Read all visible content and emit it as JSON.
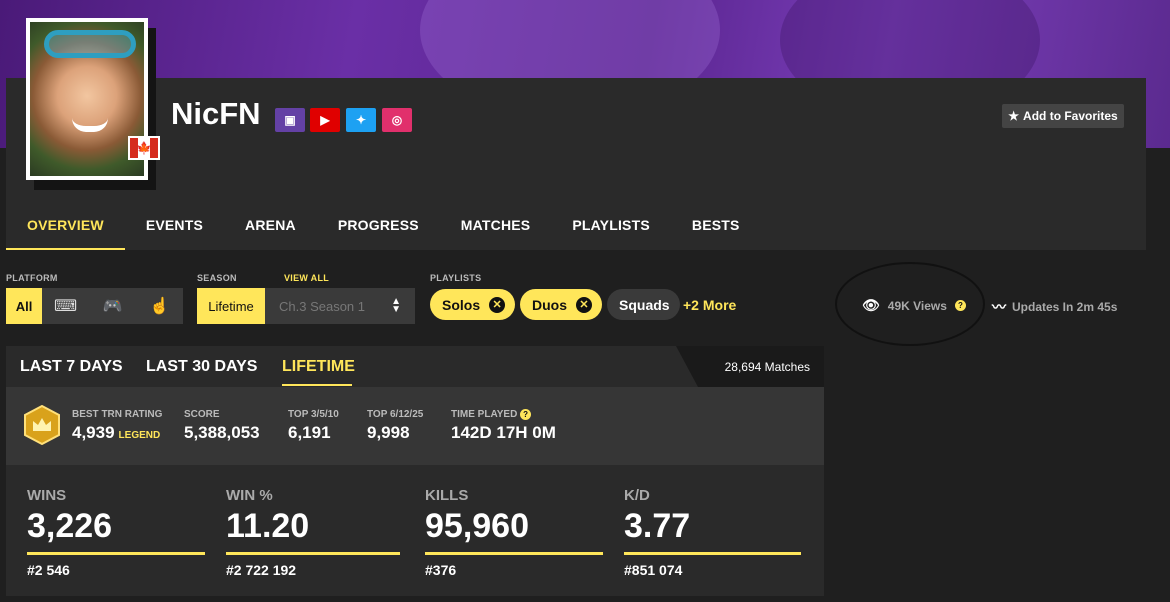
{
  "profile": {
    "name": "NicFN",
    "flag": "🍁",
    "favorite_label": "Add to Favorites",
    "social": [
      {
        "icon": "twitch-icon",
        "color": "#6441a5",
        "glyph": "▣"
      },
      {
        "icon": "youtube-icon",
        "color": "#e00000",
        "glyph": "▶"
      },
      {
        "icon": "twitter-icon",
        "color": "#1da1f2",
        "glyph": "✦"
      },
      {
        "icon": "instagram-icon",
        "color": "#e1306c",
        "glyph": "◎"
      }
    ]
  },
  "nav": {
    "tabs": [
      "OVERVIEW",
      "EVENTS",
      "ARENA",
      "PROGRESS",
      "MATCHES",
      "PLAYLISTS",
      "BESTS"
    ]
  },
  "filters": {
    "platform_label": "PLATFORM",
    "platform_all": "All",
    "season_label": "SEASON",
    "season_view_all": "VIEW ALL",
    "season_lifetime": "Lifetime",
    "season_select": "Ch.3 Season 1",
    "playlists_label": "PLAYLISTS",
    "playlists": [
      "Solos",
      "Duos",
      "Squads"
    ],
    "more": "+2 More",
    "views": "49K Views",
    "updates": "Updates In 2m 45s"
  },
  "range": {
    "tabs": [
      "LAST 7 DAYS",
      "LAST 30 DAYS",
      "LIFETIME"
    ],
    "matches": "28,694 Matches"
  },
  "meta": {
    "best_trn_label": "BEST TRN RATING",
    "best_trn_value": "4,939",
    "best_trn_tier": "LEGEND",
    "score_label": "SCORE",
    "score_value": "5,388,053",
    "top3_label": "TOP 3/5/10",
    "top3_value": "6,191",
    "top6_label": "TOP 6/12/25",
    "top6_value": "9,998",
    "time_label": "TIME PLAYED",
    "time_value": "142D 17H 0M"
  },
  "stats": [
    {
      "label": "WINS",
      "value": "3,226",
      "rank": "#2 546"
    },
    {
      "label": "WIN %",
      "value": "11.20",
      "rank": "#2 722 192"
    },
    {
      "label": "KILLS",
      "value": "95,960",
      "rank": "#376"
    },
    {
      "label": "K/D",
      "value": "3.77",
      "rank": "#851 074"
    }
  ],
  "colors": {
    "accent": "#ffe65a",
    "background": "#1f1f1f",
    "panel": "#2a2a2a"
  }
}
